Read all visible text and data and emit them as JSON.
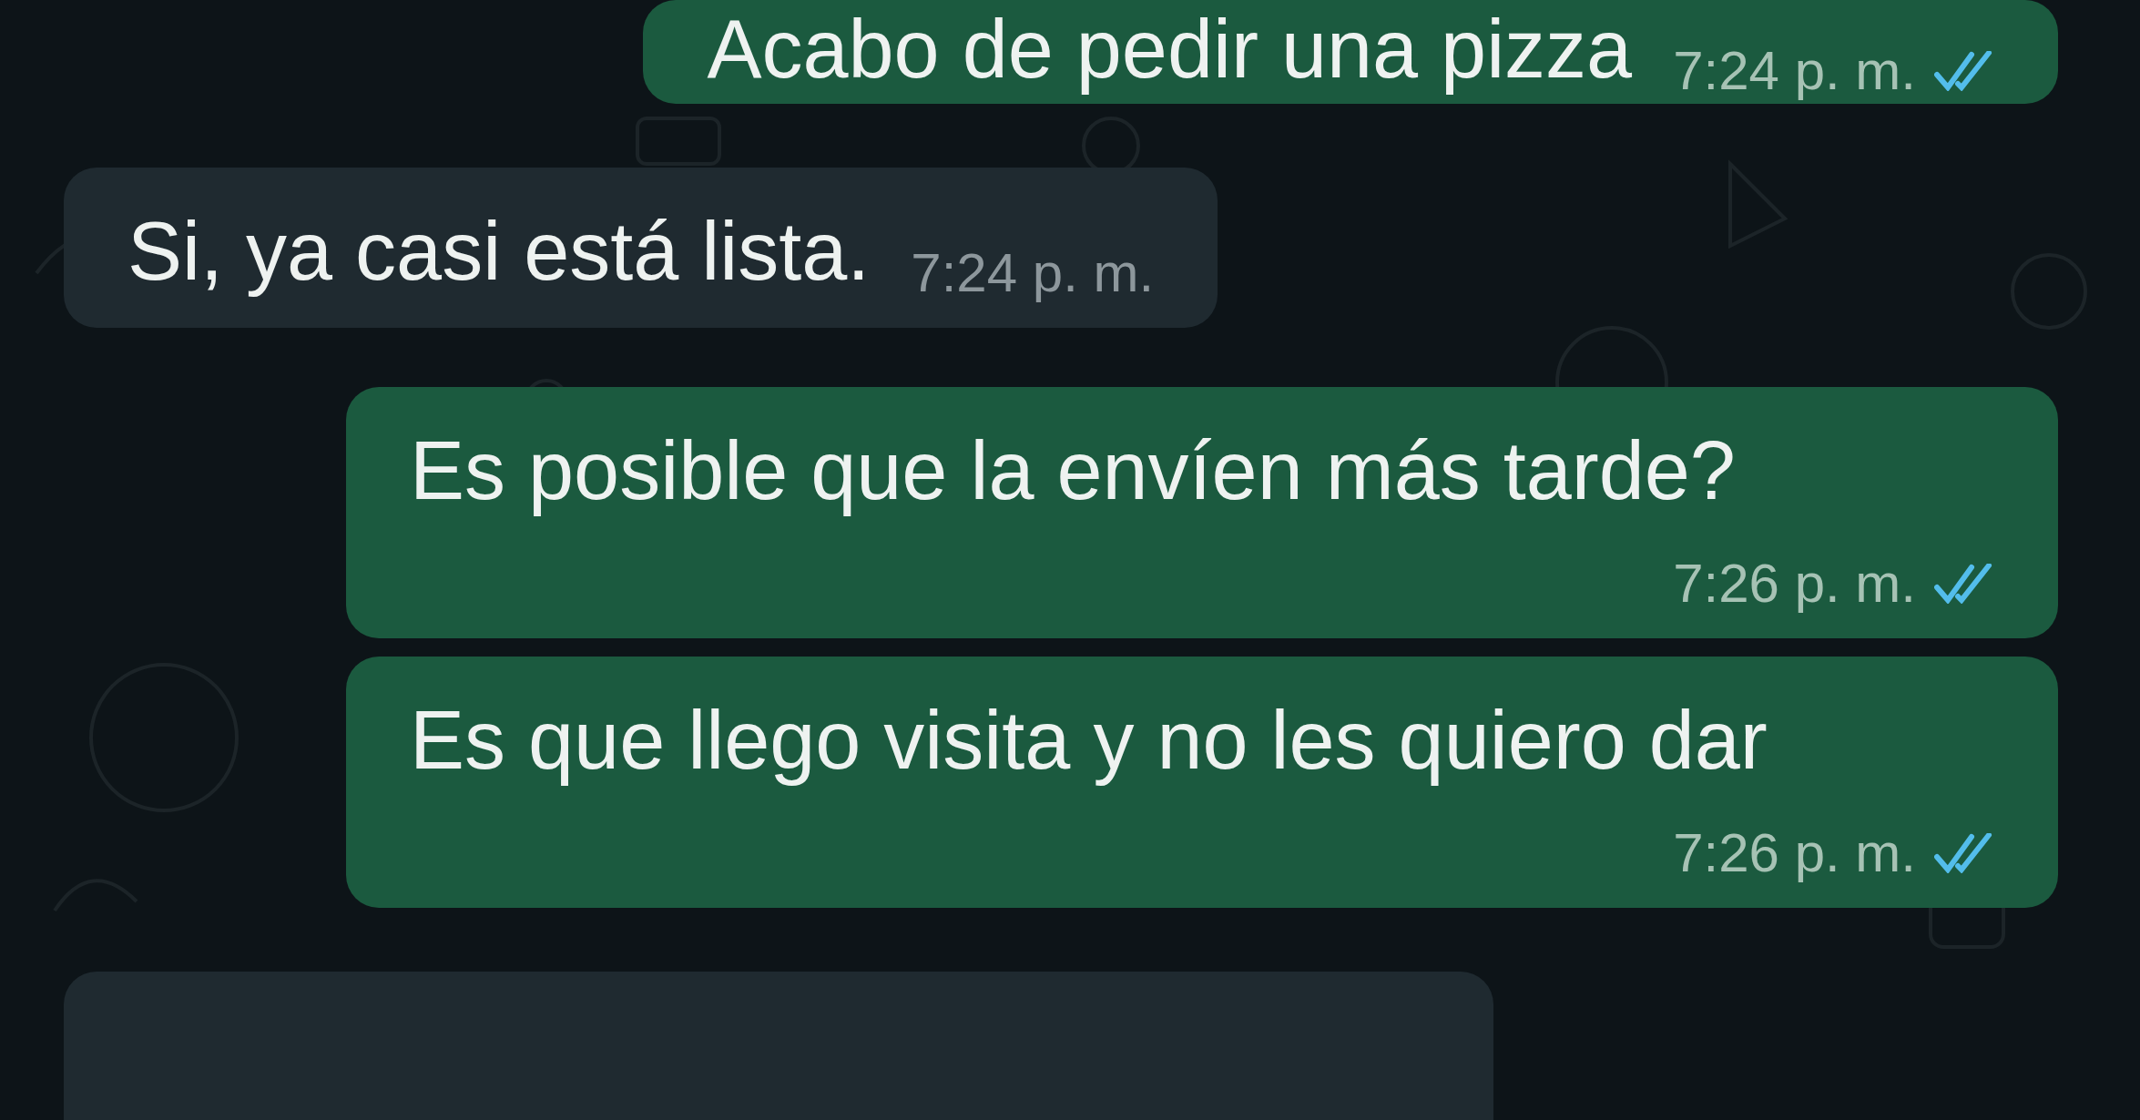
{
  "messages": [
    {
      "kind": "outgoing",
      "text": "Acabo de pedir una pizza",
      "time": "7:24 p. m.",
      "read": true
    },
    {
      "kind": "incoming",
      "text": "Si, ya casi está lista.",
      "time": "7:24 p. m."
    },
    {
      "kind": "outgoing",
      "text": "Es posible que la envíen más tarde?",
      "time": "7:26 p. m.",
      "read": true
    },
    {
      "kind": "outgoing",
      "text": "Es que llego visita y no les quiero dar",
      "time": "7:26 p. m.",
      "read": true
    },
    {
      "kind": "incoming"
    }
  ]
}
